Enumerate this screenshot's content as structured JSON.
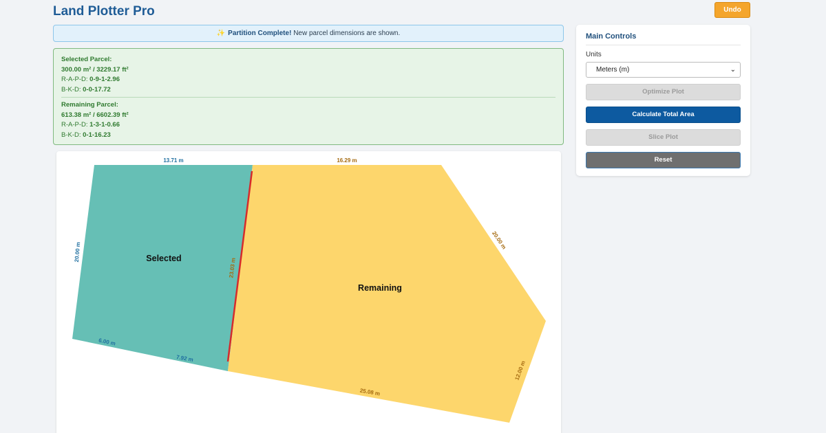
{
  "header": {
    "title": "Land Plotter Pro",
    "undo_label": "Undo"
  },
  "status": {
    "icon": "sparkles-icon",
    "strong": "Partition Complete!",
    "message": "New parcel dimensions are shown."
  },
  "selected_parcel": {
    "heading": "Selected Parcel:",
    "area": "300.00 m² / 3229.17 ft²",
    "rapd_label": "R-A-P-D:",
    "rapd_value": "0-9-1-2.96",
    "bkd_label": "B-K-D:",
    "bkd_value": "0-0-17.72"
  },
  "remaining_parcel": {
    "heading": "Remaining Parcel:",
    "area": "613.38 m² / 6602.39 ft²",
    "rapd_label": "R-A-P-D:",
    "rapd_value": "1-3-1-0.66",
    "bkd_label": "B-K-D:",
    "bkd_value": "0-1-16.23"
  },
  "plot": {
    "selected_label": "Selected",
    "remaining_label": "Remaining",
    "dims": {
      "top_selected": "13.71 m",
      "top_remaining": "16.29 m",
      "left": "20.00 m",
      "cut": "23.03 m",
      "right_diag": "20.00 m",
      "right_bottom": "12.00 m",
      "bottom_left_a": "6.00 m",
      "bottom_left_b": "7.92 m",
      "bottom_remaining": "25.08 m"
    },
    "colors": {
      "selected_fill": "#66bfb5",
      "remaining_fill": "#fdd66c",
      "cut_line": "#d62b2b",
      "selected_text": "#1f6fa0",
      "remaining_text": "#a56a10"
    }
  },
  "controls": {
    "title": "Main Controls",
    "units_label": "Units",
    "units_value": "Meters (m)",
    "optimize_label": "Optimize Plot",
    "calculate_label": "Calculate Total Area",
    "slice_label": "Slice Plot",
    "reset_label": "Reset"
  }
}
